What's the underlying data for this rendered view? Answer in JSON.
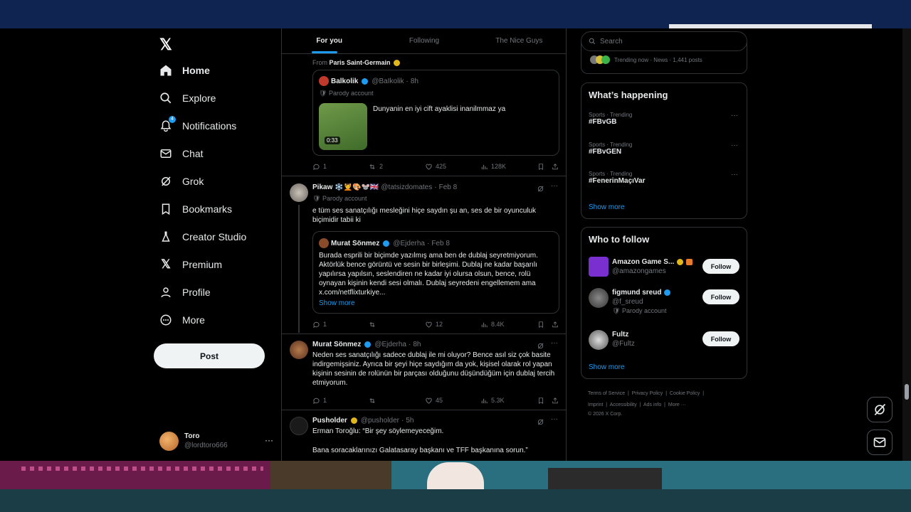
{
  "nav": {
    "items": [
      {
        "label": "Home",
        "icon": "home-icon"
      },
      {
        "label": "Explore",
        "icon": "search-icon"
      },
      {
        "label": "Notifications",
        "icon": "bell-icon",
        "badge": "4"
      },
      {
        "label": "Chat",
        "icon": "mail-icon"
      },
      {
        "label": "Grok",
        "icon": "grok-icon"
      },
      {
        "label": "Bookmarks",
        "icon": "bookmark-icon"
      },
      {
        "label": "Creator Studio",
        "icon": "flask-icon"
      },
      {
        "label": "Premium",
        "icon": "x-icon"
      },
      {
        "label": "Profile",
        "icon": "person-icon"
      },
      {
        "label": "More",
        "icon": "more-circle-icon"
      }
    ],
    "post_label": "Post",
    "account": {
      "name": "Toro",
      "handle": "@lordtoro666"
    }
  },
  "tabs": [
    "For you",
    "Following",
    "The Nice Guys"
  ],
  "posts": {
    "p1": {
      "context": "From",
      "context_name": "Paris Saint-Germain",
      "quote": {
        "name": "Balkolik",
        "handle": "@BaIkolik",
        "time": "8h",
        "parody": "Parody account",
        "text": "Dunyanin en iyi cift ayaklisi inanilmmaz ya",
        "duration": "0:33"
      },
      "replies": "1",
      "reposts": "2",
      "likes": "425",
      "views": "128K"
    },
    "p2": {
      "name": "Pikaw ❄️💆🎨🐭🇬🇧",
      "handle": "@tatsizdomates",
      "time": "Feb 8",
      "parody": "Parody account",
      "text": "e tüm ses sanatçılığı mesleğini hiçe saydın şu an, ses de bir oyunculuk biçimidir tabii ki",
      "quote": {
        "name": "Murat Sönmez",
        "handle": "@Ejderha",
        "time": "Feb 8",
        "text": "Burada esprili bir biçimde yazılmış ama ben de dublaj seyretmiyorum. Aktörlük bence görüntü ve sesin bir birleşimi. Dublaj ne kadar başarılı yapılırsa yapılsın, seslendiren ne kadar iyi olursa olsun, bence, rolü oynayan kişinin kendi sesi olmalı. Dublaj seyredeni engellemem ama x.com/netflixturkiye...",
        "show_more": "Show more"
      },
      "replies": "1",
      "reposts": "",
      "likes": "12",
      "views": "8.4K"
    },
    "p3": {
      "name": "Murat Sönmez",
      "handle": "@Ejderha",
      "time": "8h",
      "text": "Neden ses sanatçılığı sadece dublaj ile mi oluyor? Bence asıl siz çok basite indirgemişsiniz. Ayrıca bir şeyi hiçe saydığım da yok, kişisel olarak rol yapan kişinin sesinin de rolünün bir parçası olduğunu düşündüğüm için dublaj tercih etmiyorum.",
      "replies": "1",
      "reposts": "",
      "likes": "45",
      "views": "5.3K"
    },
    "p4": {
      "name": "Pusholder",
      "handle": "@pusholder",
      "time": "5h",
      "line1": "Erman Toroğlu: “Bir şey söylemeyeceğim.",
      "line2": "Bana soracaklarınızı Galatasaray başkanı ve TFF başkanına sorun.”"
    }
  },
  "right": {
    "search_placeholder": "Search",
    "trending_now": "Trending now · News · 1,441 posts",
    "happening": {
      "title": "What’s happening",
      "trends": [
        {
          "category": "Sports · Trending",
          "name": "#FBvGB"
        },
        {
          "category": "Sports · Trending",
          "name": "#FBvGEN"
        },
        {
          "category": "Sports · Trending",
          "name": "#FenerinMaçıVar"
        }
      ],
      "show_more": "Show more"
    },
    "follow": {
      "title": "Who to follow",
      "users": [
        {
          "name": "Amazon Game S...",
          "handle": "@amazongames",
          "extra": "",
          "button": "Follow"
        },
        {
          "name": "figmund sreud",
          "handle": "@f_sreud",
          "extra": "Parody account",
          "button": "Follow"
        },
        {
          "name": "Fultz",
          "handle": "@Fultz",
          "extra": "",
          "button": "Follow"
        }
      ],
      "show_more": "Show more"
    },
    "footer": {
      "line1": [
        "Terms of Service",
        "Privacy Policy",
        "Cookie Policy"
      ],
      "line2": [
        "Imprint",
        "Accessibility",
        "Ads info",
        "More ···"
      ],
      "copyright": "© 2026 X Corp."
    }
  },
  "colors": {
    "accent": "#1d9bf0",
    "background": "#000000",
    "border": "#2f3336",
    "muted": "#71767b"
  }
}
